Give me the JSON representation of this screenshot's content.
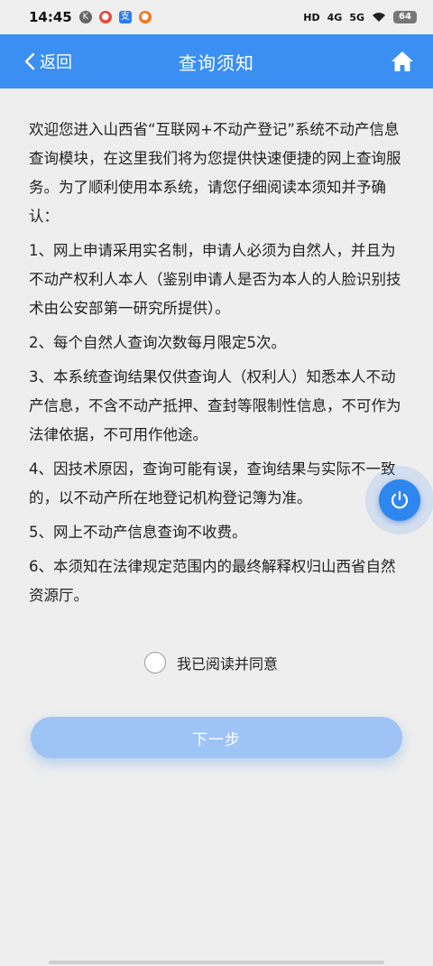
{
  "status_bar": {
    "time": "14:45",
    "network1": "HD",
    "network2": "4G",
    "network3": "5G",
    "battery": "64"
  },
  "nav": {
    "back_label": "返回",
    "title": "查询须知"
  },
  "content": {
    "intro": "欢迎您进入山西省“互联网+不动产登记”系统不动产信息查询模块，在这里我们将为您提供快速便捷的网上查询服务。为了顺利使用本系统，请您仔细阅读本须知并予确认：",
    "items": [
      "1、网上申请采用实名制，申请人必须为自然人，并且为不动产权利人本人（鉴别申请人是否为本人的人脸识别技术由公安部第一研究所提供）。",
      "2、每个自然人查询次数每月限定5次。",
      "3、本系统查询结果仅供查询人（权利人）知悉本人不动产信息，不含不动产抵押、查封等限制性信息，不可作为法律依据，不可用作他途。",
      "4、因技术原因，查询可能有误，查询结果与实际不一致的，以不动产所在地登记机构登记簿为准。",
      "5、网上不动产信息查询不收费。",
      "6、本须知在法律规定范围内的最终解释权归山西省自然资源厅。"
    ]
  },
  "agreement": {
    "label": "我已阅读并同意",
    "checked": false
  },
  "next_button": {
    "label": "下一步"
  },
  "colors": {
    "primary": "#3b8ff3",
    "button_disabled": "#9ec4f6",
    "background": "#eeeeee"
  },
  "icons": {
    "back": "chevron-left-icon",
    "home": "home-icon",
    "floating": "power-icon"
  }
}
